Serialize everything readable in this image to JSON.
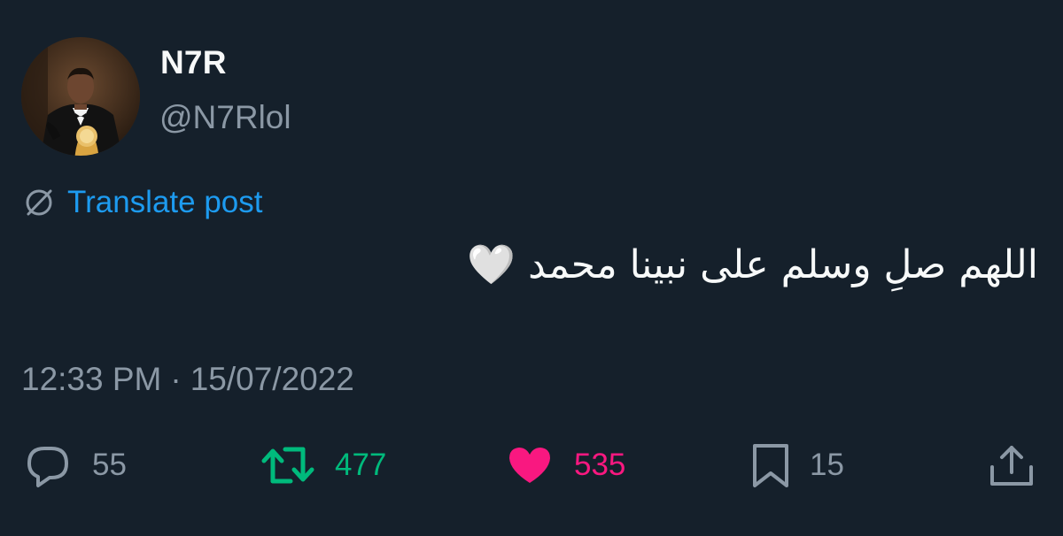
{
  "author": {
    "display_name": "N7R",
    "handle": "@N7Rlol",
    "avatar_icon": "profile-photo-man-in-tuxedo"
  },
  "translate": {
    "label": "Translate post",
    "icon": "translate-globe-icon",
    "color": "#1d9bf0"
  },
  "post": {
    "text": "اللهم صلِ وسلم على نبينا محمد 🤍"
  },
  "meta": {
    "time": "12:33 PM",
    "separator": "·",
    "date": "15/07/2022"
  },
  "actions": {
    "reply": {
      "icon": "reply-bubble-icon",
      "count": "55",
      "color": "#8b98a5"
    },
    "retweet": {
      "icon": "retweet-icon",
      "count": "477",
      "color": "#00ba7c"
    },
    "like": {
      "icon": "heart-filled-icon",
      "count": "535",
      "color": "#f91880"
    },
    "bookmark": {
      "icon": "bookmark-icon",
      "count": "15",
      "color": "#8b98a5"
    },
    "share": {
      "icon": "share-upload-icon"
    }
  },
  "theme": {
    "background": "#15202b",
    "primary_text": "#f7f9f9",
    "secondary_text": "#8b98a5"
  }
}
